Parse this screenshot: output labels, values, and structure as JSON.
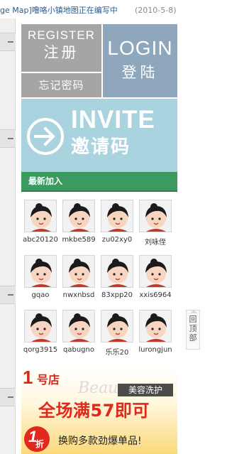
{
  "top_news": {
    "headline": "ge Map]噜咯小镇地图正在编写中",
    "date": "(2010-5-8)"
  },
  "tiles": {
    "register_en": "REGISTER",
    "register_cn": "注册",
    "login_en": "LOGIN",
    "login_cn": "登陆",
    "forgot": "忘记密码",
    "invite_en": "INVITE",
    "invite_cn": "邀请码"
  },
  "colors": {
    "gray_tile": "#a5a5a5",
    "login_tile": "#8ea7bd",
    "invite_tile": "#a9d3de",
    "new_bar": "#3a9a5f"
  },
  "new_members": {
    "title": "最新加入",
    "members": [
      "abc20120",
      "mkbe589",
      "zu02xy0",
      "刘咏侄",
      "gqao",
      "nwxnbsd",
      "83xpp20",
      "xxis6964",
      "qorg3915",
      "qabugno",
      "乐乐20",
      "lurongjun"
    ]
  },
  "back_to_top": "回顶部",
  "ad": {
    "logo_number": "1",
    "logo_text": "号店",
    "watermark": "Beau",
    "badge": "美容洗护",
    "headline": "全场满57即可",
    "circle_number": "1",
    "circle_unit": "折",
    "subline": "换购多款劲爆单品!"
  }
}
